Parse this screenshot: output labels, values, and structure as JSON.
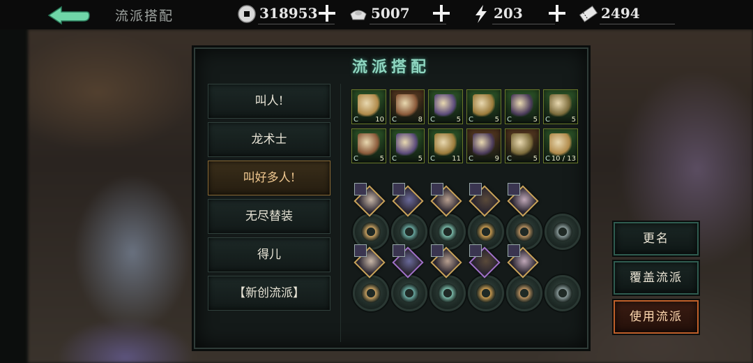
{
  "header": {
    "title": "流派搭配",
    "resources": [
      {
        "icon": "copper-coin-icon",
        "value": "318953"
      },
      {
        "icon": "silver-ingot-icon",
        "value": "5007"
      },
      {
        "icon": "lightning-stamina-icon",
        "value": "203"
      },
      {
        "icon": "ticket-icon",
        "value": "2494"
      }
    ]
  },
  "panel": {
    "title": "流派搭配",
    "factions": [
      {
        "label": "叫人!",
        "active": false
      },
      {
        "label": "龙术士",
        "active": false
      },
      {
        "label": "叫好多人!",
        "active": true
      },
      {
        "label": "无尽替装",
        "active": false
      },
      {
        "label": "得儿",
        "active": false
      },
      {
        "label": "【新创流派】",
        "active": false
      }
    ],
    "equipment_rows": [
      [
        {
          "icon": "staff-equipment-icon",
          "level": "10",
          "color": "#2f5a2a"
        },
        {
          "icon": "gauntlet-equipment-icon",
          "level": "8",
          "color": "#5a3a22"
        },
        {
          "icon": "armor-equipment-icon",
          "level": "5",
          "color": "#2f5a2a"
        },
        {
          "icon": "cloak-equipment-icon",
          "level": "5",
          "color": "#2f5a2a"
        },
        {
          "icon": "boots-equipment-icon",
          "level": "5",
          "color": "#2f5a2a"
        },
        {
          "icon": "amulet-equipment-icon",
          "level": "5",
          "color": "#2f5a2a"
        }
      ],
      [
        {
          "icon": "pendant-equipment-icon",
          "level": "5",
          "color": "#2f5a2a"
        },
        {
          "icon": "mantle-equipment-icon",
          "level": "5",
          "color": "#2f5a2a"
        },
        {
          "icon": "bracer-equipment-icon",
          "level": "11",
          "color": "#2f5a2a"
        },
        {
          "icon": "belt-equipment-icon",
          "level": "9",
          "color": "#5a3a22"
        },
        {
          "icon": "rose-robe-equipment-icon",
          "level": "5",
          "color": "#5a3a22"
        },
        {
          "icon": "sword-equipment-icon",
          "level": "10 / 13",
          "color": "#2f5a2a"
        }
      ]
    ],
    "skill_rows": [
      [
        "claw-skill-icon",
        "orb-skill-icon",
        "bird-skill-icon",
        "flame-skill-icon",
        "spike-skill-icon",
        "mask-skill-icon"
      ],
      [
        "claw-skill-icon",
        "crown-skill-icon",
        "fang-skill-icon",
        "leaf-skill-icon",
        "wave-skill-icon",
        "mask-skill-icon"
      ]
    ]
  },
  "actions": {
    "rename": "更名",
    "overwrite": "覆盖流派",
    "use": "使用流派"
  },
  "colors": {
    "accent": "#8fd6c0",
    "active_faction": "#f0c890",
    "primary_button_border": "#c0602a"
  }
}
